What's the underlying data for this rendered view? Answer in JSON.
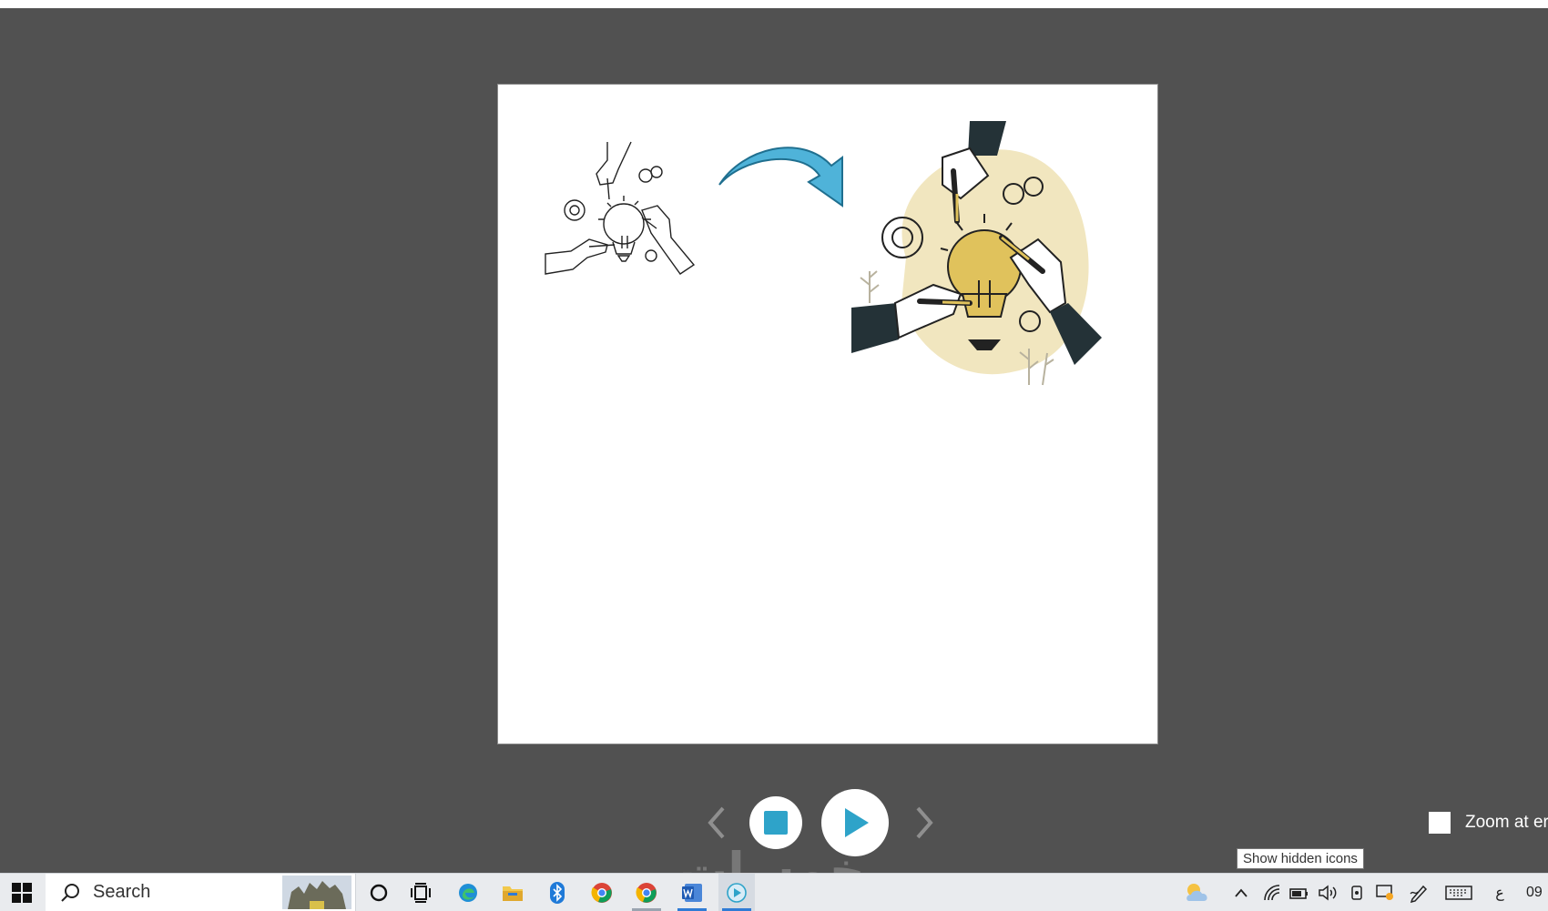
{
  "window": {
    "title": ""
  },
  "slide": {
    "arrow_color": "#4fb3d9",
    "accent_color": "#f1e6bf",
    "bulb_color": "#e0c25c"
  },
  "player": {
    "prev_icon": "chevron-left-icon",
    "stop_icon": "stop-icon",
    "play_icon": "play-icon",
    "next_icon": "chevron-right-icon",
    "accent_color": "#2ea3c9",
    "zoom_label": "Zoom at er",
    "zoom_checked": false
  },
  "tooltip": {
    "text": "Show hidden icons"
  },
  "taskbar": {
    "search_label": "Search",
    "keyboard_lang": "ع",
    "clock": "09",
    "apps": [
      "start-icon",
      "search-icon",
      "cortana-icon",
      "task-view-icon",
      "edge-icon",
      "file-explorer-icon",
      "bluetooth-icon",
      "chrome-icon",
      "chrome-icon",
      "word-icon",
      "media-player-icon"
    ]
  },
  "watermark": {
    "text": "خمسات"
  }
}
